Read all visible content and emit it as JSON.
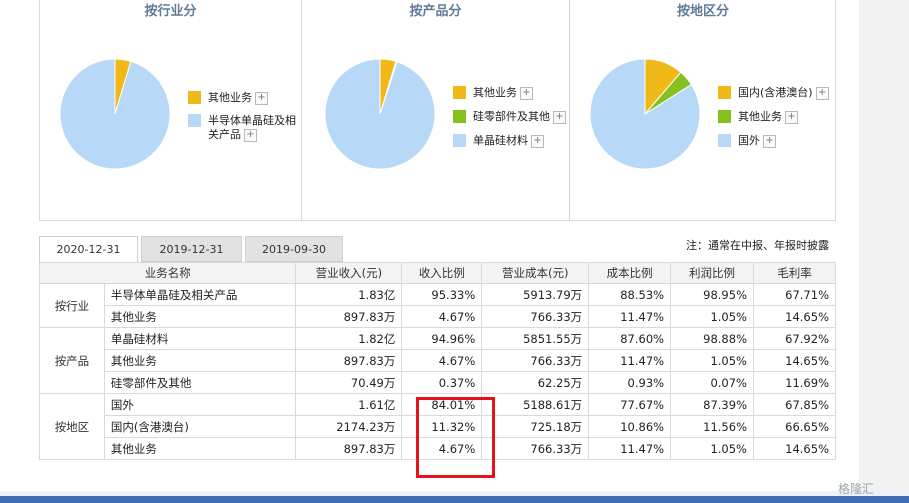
{
  "charts": [
    {
      "title": "按行业分",
      "slices": [
        {
          "label": "其他业务",
          "percent": 4.67,
          "color": "#f0b918"
        },
        {
          "label": "半导体单晶硅及相关产品",
          "percent": 95.33,
          "color": "#b7d8f6"
        }
      ]
    },
    {
      "title": "按产品分",
      "slices": [
        {
          "label": "其他业务",
          "percent": 4.67,
          "color": "#f0b918"
        },
        {
          "label": "硅零部件及其他",
          "percent": 0.37,
          "color": "#86c01f"
        },
        {
          "label": "单晶硅材料",
          "percent": 94.96,
          "color": "#b7d8f6"
        }
      ]
    },
    {
      "title": "按地区分",
      "slices": [
        {
          "label": "国内(含港澳台)",
          "percent": 11.32,
          "color": "#f0b918"
        },
        {
          "label": "其他业务",
          "percent": 4.67,
          "color": "#86c01f"
        },
        {
          "label": "国外",
          "percent": 84.01,
          "color": "#b7d8f6"
        }
      ]
    }
  ],
  "plus_symbol": "+",
  "tabs": [
    "2020-12-31",
    "2019-12-31",
    "2019-09-30"
  ],
  "note": "注：通常在中报、年报时披露",
  "table": {
    "headers": [
      "业务名称",
      "营业收入(元)",
      "收入比例",
      "营业成本(元)",
      "成本比例",
      "利润比例",
      "毛利率"
    ],
    "groups": [
      {
        "label": "按行业",
        "rows": [
          [
            "半导体单晶硅及相关产品",
            "1.83亿",
            "95.33%",
            "5913.79万",
            "88.53%",
            "98.95%",
            "67.71%"
          ],
          [
            "其他业务",
            "897.83万",
            "4.67%",
            "766.33万",
            "11.47%",
            "1.05%",
            "14.65%"
          ]
        ]
      },
      {
        "label": "按产品",
        "rows": [
          [
            "单晶硅材料",
            "1.82亿",
            "94.96%",
            "5851.55万",
            "87.60%",
            "98.88%",
            "67.92%"
          ],
          [
            "其他业务",
            "897.83万",
            "4.67%",
            "766.33万",
            "11.47%",
            "1.05%",
            "14.65%"
          ],
          [
            "硅零部件及其他",
            "70.49万",
            "0.37%",
            "62.25万",
            "0.93%",
            "0.07%",
            "11.69%"
          ]
        ]
      },
      {
        "label": "按地区",
        "rows": [
          [
            "国外",
            "1.61亿",
            "84.01%",
            "5188.61万",
            "77.67%",
            "87.39%",
            "67.85%"
          ],
          [
            "国内(含港澳台)",
            "2174.23万",
            "11.32%",
            "725.18万",
            "10.86%",
            "11.56%",
            "66.65%"
          ],
          [
            "其他业务",
            "897.83万",
            "4.67%",
            "766.33万",
            "11.47%",
            "1.05%",
            "14.65%"
          ]
        ]
      }
    ]
  },
  "watermark": "格隆汇"
}
